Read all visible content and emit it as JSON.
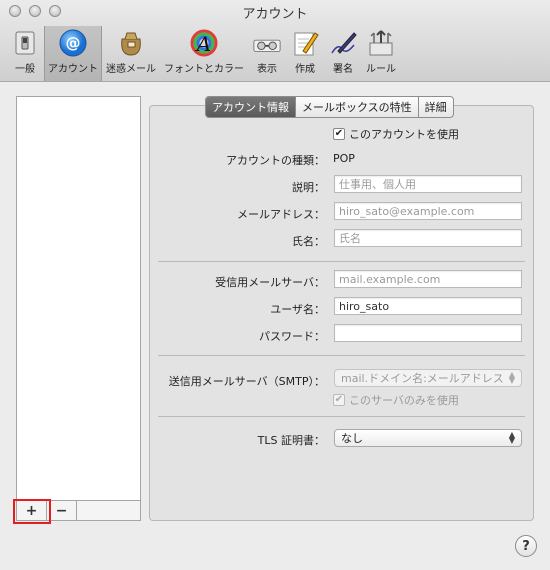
{
  "window": {
    "title": "アカウント"
  },
  "toolbar": {
    "items": [
      {
        "label": "一般",
        "icon": "general-switch-icon"
      },
      {
        "label": "アカウント",
        "icon": "at-sign-icon"
      },
      {
        "label": "迷惑メール",
        "icon": "junk-mail-bag-icon"
      },
      {
        "label": "フォントとカラー",
        "icon": "fonts-colors-icon"
      },
      {
        "label": "表示",
        "icon": "view-glasses-icon"
      },
      {
        "label": "作成",
        "icon": "compose-pencil-icon"
      },
      {
        "label": "署名",
        "icon": "signature-pen-icon"
      },
      {
        "label": "ルール",
        "icon": "rules-arrows-icon"
      }
    ],
    "selected": "アカウント"
  },
  "account_list": {
    "add_label": "+",
    "remove_label": "−"
  },
  "tabs": [
    {
      "label": "アカウント情報",
      "active": true
    },
    {
      "label": "メールボックスの特性",
      "active": false
    },
    {
      "label": "詳細",
      "active": false
    }
  ],
  "form": {
    "use_account": {
      "label": "このアカウントを使用",
      "checked": true
    },
    "account_type": {
      "label": "アカウントの種類：",
      "value": "POP"
    },
    "description": {
      "label": "説明：",
      "value": "",
      "placeholder": "仕事用、個人用"
    },
    "email": {
      "label": "メールアドレス：",
      "value": "",
      "placeholder": "hiro_sato@example.com"
    },
    "full_name": {
      "label": "氏名：",
      "value": "",
      "placeholder": "氏名"
    },
    "incoming_server": {
      "label": "受信用メールサーバ：",
      "value": "",
      "placeholder": "mail.example.com"
    },
    "username": {
      "label": "ユーザ名：",
      "value": "hiro_sato"
    },
    "password": {
      "label": "パスワード：",
      "value": ""
    },
    "smtp": {
      "label": "送信用メールサーバ（SMTP）：",
      "value": "mail.ドメイン名:メールアドレス"
    },
    "only_this_server": {
      "label": "このサーバのみを使用",
      "checked": true
    },
    "tls_certificate": {
      "label": "TLS 証明書：",
      "value": "なし"
    }
  },
  "help": {
    "label": "?"
  },
  "colors": {
    "highlight": "#e02020",
    "tab_active": "#6a6a6a"
  }
}
